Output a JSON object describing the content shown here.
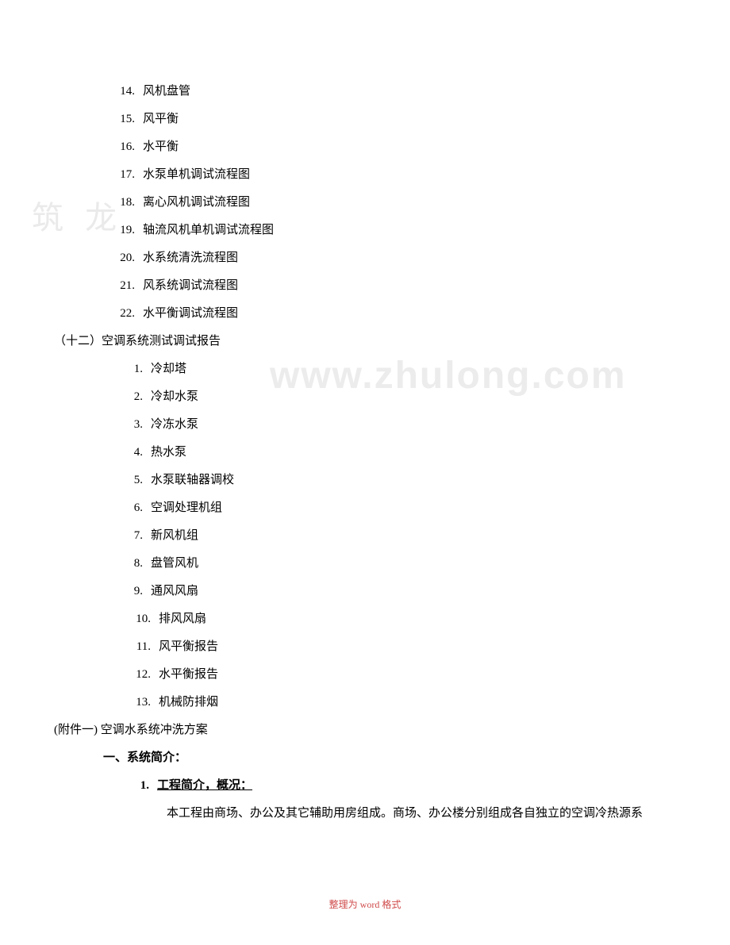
{
  "toc_continued": [
    {
      "num": "14.",
      "text": "风机盘管"
    },
    {
      "num": "15.",
      "text": "风平衡"
    },
    {
      "num": "16.",
      "text": "水平衡"
    },
    {
      "num": "17.",
      "text": "水泵单机调试流程图"
    },
    {
      "num": "18.",
      "text": "离心风机调试流程图"
    },
    {
      "num": "19.",
      "text": "轴流风机单机调试流程图"
    },
    {
      "num": "20.",
      "text": "水系统清洗流程图"
    },
    {
      "num": "21.",
      "text": "风系统调试流程图"
    },
    {
      "num": "22.",
      "text": "水平衡调试流程图"
    }
  ],
  "section_12": {
    "heading": "（十二）空调系统测试调试报告",
    "items": [
      {
        "num": "1.",
        "text": "冷却塔"
      },
      {
        "num": "2.",
        "text": "冷却水泵"
      },
      {
        "num": "3.",
        "text": "冷冻水泵"
      },
      {
        "num": "4.",
        "text": "热水泵"
      },
      {
        "num": "5.",
        "text": "水泵联轴器调校"
      },
      {
        "num": "6.",
        "text": "空调处理机组"
      },
      {
        "num": "7.",
        "text": "新风机组"
      },
      {
        "num": "8.",
        "text": "盘管风机"
      },
      {
        "num": "9.",
        "text": "通风风扇"
      },
      {
        "num": "10.",
        "text": "排风风扇"
      },
      {
        "num": "11.",
        "text": "风平衡报告"
      },
      {
        "num": "12.",
        "text": "水平衡报告"
      },
      {
        "num": "13.",
        "text": "机械防排烟"
      }
    ]
  },
  "appendix": {
    "heading": "(附件一)  空调水系统冲洗方案",
    "section_heading_prefix": "一、",
    "section_heading_text": "系统简介：",
    "sub_heading_num": "1.",
    "sub_heading_text": "工程简介，概况：",
    "paragraph": "本工程由商场、办公及其它辅助用房组成。商场、办公楼分别组成各自独立的空调冷热源系"
  },
  "footer": {
    "prefix": "整理为",
    "word": "word",
    "suffix": "格式"
  },
  "watermark1": "筑 龙",
  "watermark2": "www.zhulong.com"
}
